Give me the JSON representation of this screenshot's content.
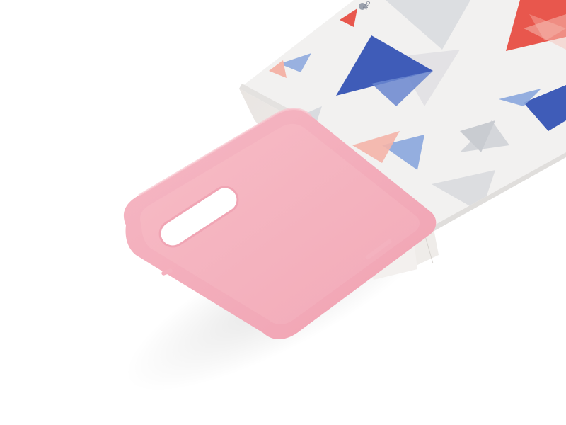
{
  "photo": {
    "subject": "pink-silicone-phone-case",
    "background_color": "#ffffff",
    "case_color": "#f2aab8",
    "case_rim_color": "#f09aac",
    "box_base_color": "#f2f1f0",
    "pattern_colors": {
      "blue": "#3f5cb8",
      "light_blue": "#8aa6dd",
      "red": "#e8574d",
      "pink": "#f4b4a8",
      "grey": "#d6d8dc"
    },
    "box_text": "Mo"
  }
}
